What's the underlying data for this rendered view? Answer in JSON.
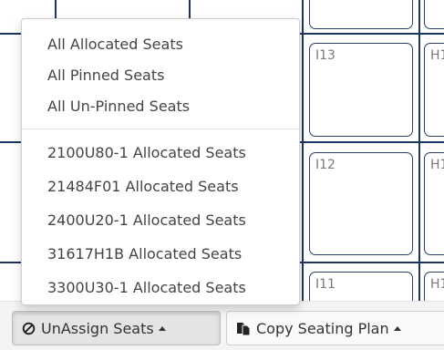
{
  "seats": [
    {
      "label": "I13"
    },
    {
      "label": "H1"
    },
    {
      "label": "I12"
    },
    {
      "label": "H1"
    },
    {
      "label": "I11"
    },
    {
      "label": "H1"
    }
  ],
  "dropdown": {
    "group1": [
      {
        "label": "All Allocated Seats"
      },
      {
        "label": "All Pinned Seats"
      },
      {
        "label": "All Un-Pinned Seats"
      }
    ],
    "group2": [
      {
        "label": "2100U80-1 Allocated Seats"
      },
      {
        "label": "21484F01 Allocated Seats"
      },
      {
        "label": "2400U20-1 Allocated Seats"
      },
      {
        "label": "31617H1B Allocated Seats"
      },
      {
        "label": "3300U30-1 Allocated Seats"
      }
    ]
  },
  "toolbar": {
    "unassign_label": "UnAssign Seats",
    "unassign_icon": "ban-icon",
    "copy_label": "Copy Seating Plan",
    "copy_icon": "copy-files-icon"
  },
  "colors": {
    "grid_line": "#1d3561",
    "seat_border": "#2b3f63",
    "seat_label": "#7a7a7a"
  }
}
